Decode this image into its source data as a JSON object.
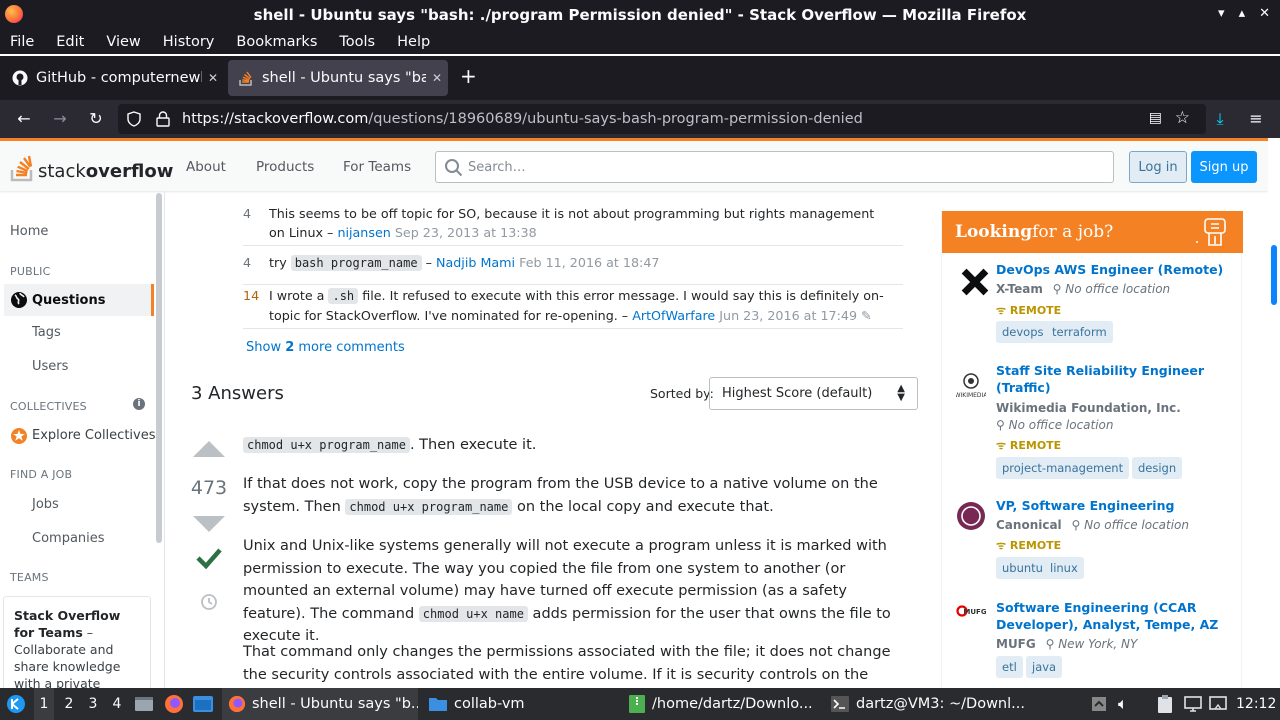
{
  "window": {
    "title": "shell - Ubuntu says \"bash: ./program Permission denied\" - Stack Overflow — Mozilla Firefox"
  },
  "menu": [
    "File",
    "Edit",
    "View",
    "History",
    "Bookmarks",
    "Tools",
    "Help"
  ],
  "tabs": [
    {
      "label": "GitHub - computernewb/",
      "active": false
    },
    {
      "label": "shell - Ubuntu says \"bash",
      "active": true
    }
  ],
  "url": {
    "host": "https://stackoverflow.com",
    "path": "/questions/18960689/ubuntu-says-bash-program-permission-denied"
  },
  "so_header": {
    "logo_a": "stack",
    "logo_b": "overflow",
    "nav": [
      "About",
      "Products",
      "For Teams"
    ],
    "search_placeholder": "Search…",
    "login": "Log in",
    "signup": "Sign up"
  },
  "sidebar": {
    "home": "Home",
    "public": "PUBLIC",
    "questions": "Questions",
    "tags": "Tags",
    "users": "Users",
    "collectives": "COLLECTIVES",
    "explore": "Explore Collectives",
    "findjob": "FIND A JOB",
    "jobs": "Jobs",
    "companies": "Companies",
    "teams": "TEAMS",
    "teams_title": "Stack Overflow for Teams",
    "teams_text": " – Collaborate and share knowledge with a private group."
  },
  "comments": [
    {
      "score": "4",
      "text": "This seems to be off topic for SO, because it is not about programming but rights management on Linux – ",
      "user": "nijansen",
      "time": "Sep 23, 2013 at 13:38"
    },
    {
      "score": "4",
      "pre": "try ",
      "code": "bash program_name",
      "dash": " – ",
      "user": "Nadjib Mami",
      "time": "Feb 11, 2016 at 18:47"
    },
    {
      "score": "14",
      "pre": "I wrote a ",
      "code": ".sh",
      "text": " file. It refused to execute with this error message. I would say this is definitely on-topic for StackOverflow. I've nominated for re-opening. – ",
      "user": "ArtOfWarfare",
      "time": "Jun 23, 2016 at 17:49"
    }
  ],
  "show_more": {
    "pre": "Show ",
    "count": "2",
    "post": " more comments"
  },
  "answers": {
    "heading": "3 Answers",
    "sorted_by": "Sorted by:",
    "sort_value": "Highest Score (default)",
    "score": "473"
  },
  "answer": {
    "p1_code": "chmod u+x program_name",
    "p1_text": ". Then execute it.",
    "p2_a": "If that does not work, copy the program from the USB device to a native volume on the system. Then ",
    "p2_code": "chmod u+x program_name",
    "p2_b": " on the local copy and execute that.",
    "p3_a": "Unix and Unix-like systems generally will not execute a program unless it is marked with permission to execute. The way you copied the file from one system to another (or mounted an external volume) may have turned off execute permission (as a safety feature). The command ",
    "p3_code": "chmod u+x name",
    "p3_b": " adds permission for the user that owns the file to execute it.",
    "p4": "That command only changes the permissions associated with the file; it does not change the security controls associated with the entire volume. If it is security controls on the volume that are"
  },
  "jobs": {
    "head_a": "Looking",
    "head_b": " for a job?",
    "items": [
      {
        "title": "DevOps AWS Engineer (Remote)",
        "company": "X-Team",
        "location": "No office location",
        "remote": "REMOTE",
        "tags": [
          "devops",
          "terraform"
        ]
      },
      {
        "title": "Staff Site Reliability Engineer (Traffic)",
        "company": "Wikimedia Foundation, Inc.",
        "location": "No office location",
        "remote": "REMOTE",
        "tags": [
          "project-management",
          "design"
        ]
      },
      {
        "title": "VP, Software Engineering",
        "company": "Canonical",
        "location": "No office location",
        "remote": "REMOTE",
        "tags": [
          "ubuntu",
          "linux"
        ]
      },
      {
        "title": "Software Engineering (CCAR Developer), Analyst, Tempe, AZ",
        "company": "MUFG",
        "location": "New York, NY",
        "tags": [
          "etl",
          "java"
        ]
      }
    ]
  },
  "taskbar": {
    "workspaces": [
      "1",
      "2",
      "3",
      "4"
    ],
    "items": [
      "shell - Ubuntu says \"b...",
      "collab-vm",
      "/home/dartz/Downlo...",
      "dartz@VM3: ~/Downl..."
    ],
    "clock": "12:12"
  }
}
